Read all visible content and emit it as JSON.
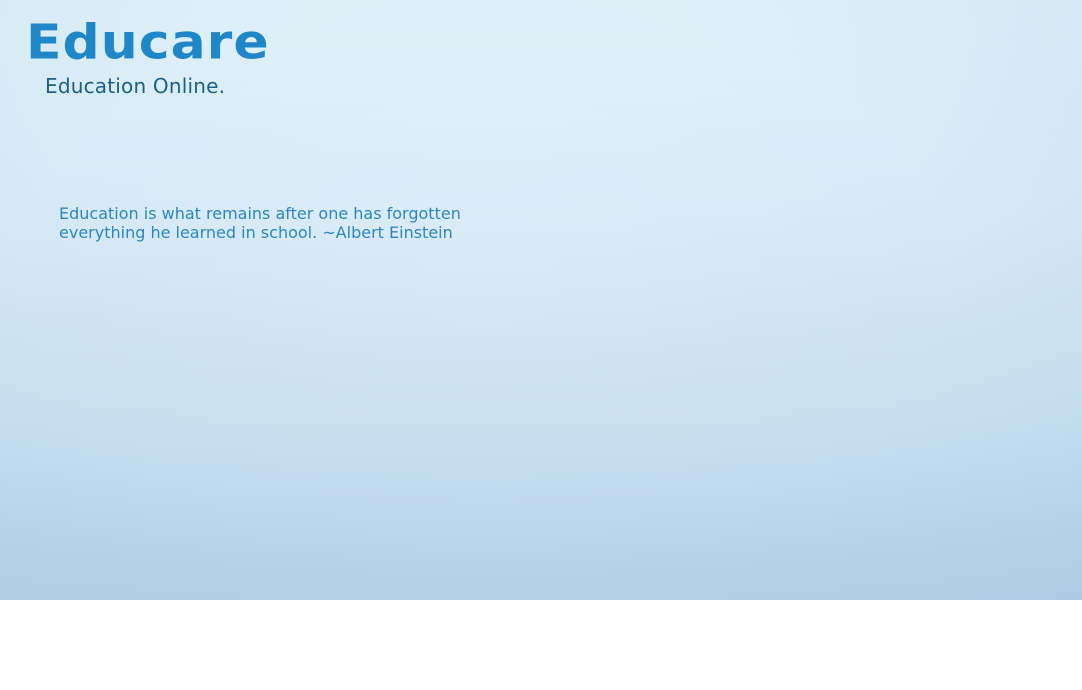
{
  "site": {
    "logo_title": "Educare",
    "tagline": "Education Online."
  },
  "hero": {
    "quote_line_1": "Education is what remains after one has forgotten",
    "quote_line_2": "everything he learned in school. ~Albert Einstein"
  },
  "colors": {
    "logo_blue": "#1f87c8",
    "tagline_blue": "#1b5f86",
    "quote_blue": "#2c86c3",
    "hero_top": "#dff1f9",
    "hero_bottom": "#b7d0e8",
    "page_bg": "#ffffff"
  }
}
